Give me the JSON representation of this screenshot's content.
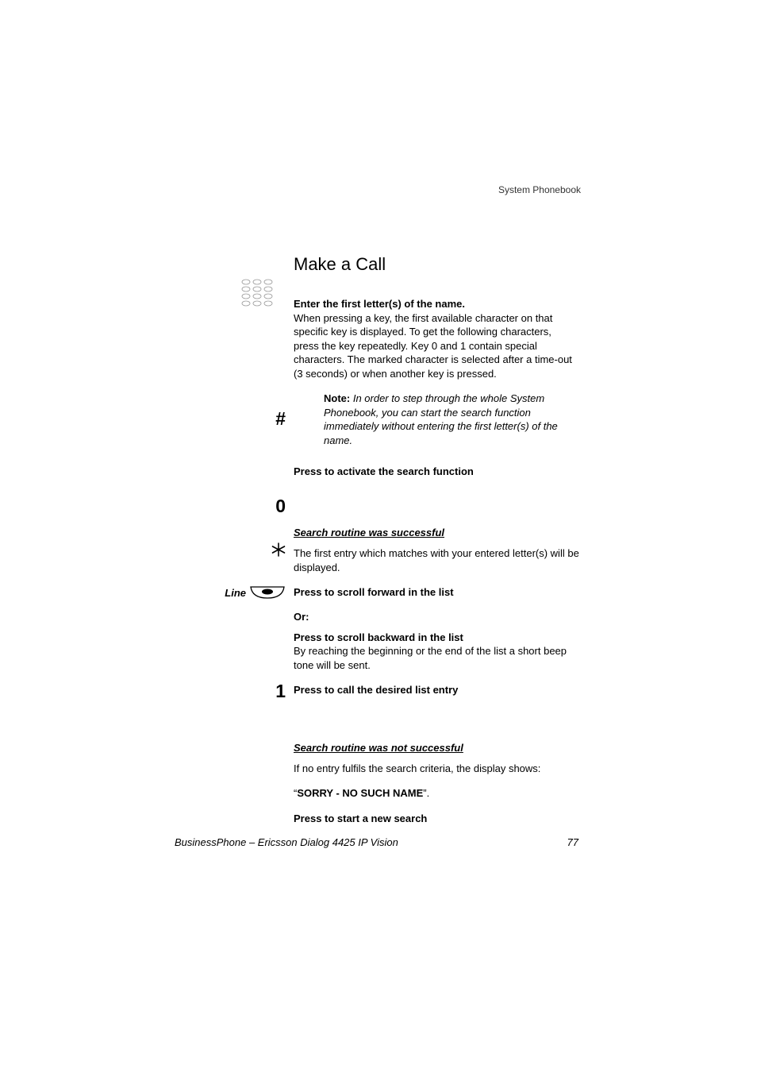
{
  "header": "System Phonebook",
  "title": "Make a Call",
  "step1": {
    "heading": "Enter the first letter(s) of the name.",
    "body": "When pressing a key, the first available character on that specific key is displayed. To get the following characters, press the key repeatedly. Key 0 and 1 contain special characters. The marked character is selected after a time-out (3 seconds) or when another key is pressed."
  },
  "note": {
    "label": "Note:",
    "text": " In order to step through the whole System Phonebook, you can start the search function immediately without entering the first letter(s) of the name."
  },
  "hash_step": "Press to activate the search function",
  "success": {
    "heading": "Search routine was successful",
    "intro": "The first entry which matches with your entered letter(s) will be displayed.",
    "zero": "Press to scroll forward in the list",
    "or": "Or:",
    "star": "Press to scroll backward in the list",
    "star_body": "By reaching the beginning or the end of the list a short beep tone will be sent.",
    "line": "Press to call the desired list entry"
  },
  "fail": {
    "heading": "Search routine was not successful",
    "intro": "If no entry fulfils the search criteria, the display shows:",
    "msg_open": "“",
    "msg": "SORRY - NO SUCH NAME",
    "msg_close": "”.",
    "one": "Press to start a new search"
  },
  "keys": {
    "hash": "#",
    "zero": "0",
    "star": "*",
    "one": "1",
    "line": "Line"
  },
  "footer": {
    "left": "BusinessPhone – Ericsson Dialog 4425 IP Vision",
    "right": "77"
  }
}
